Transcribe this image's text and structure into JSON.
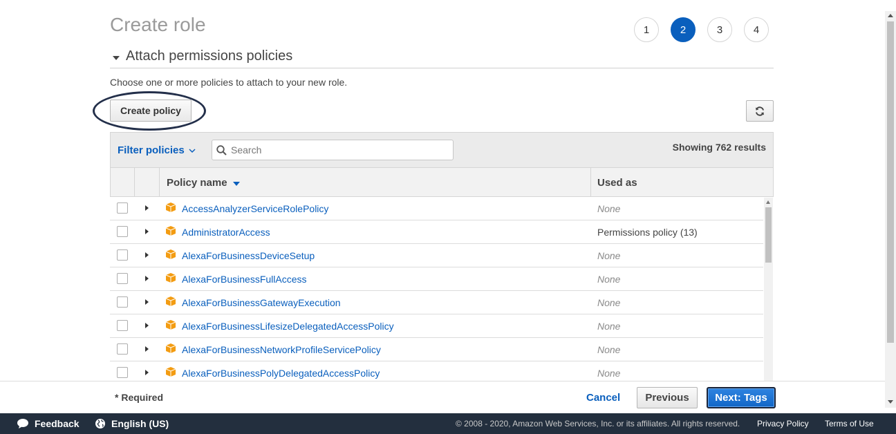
{
  "page": {
    "title": "Create role",
    "steps": [
      "1",
      "2",
      "3",
      "4"
    ],
    "active_step": "2"
  },
  "section": {
    "title": "Attach permissions policies",
    "helper": "Choose one or more policies to attach to your new role."
  },
  "toolbar": {
    "create_policy_label": "Create policy",
    "refresh_icon": "refresh-icon"
  },
  "filter": {
    "label": "Filter policies",
    "search_placeholder": "Search",
    "results": "Showing 762 results"
  },
  "table": {
    "columns": [
      "Policy name",
      "Used as"
    ],
    "rows": [
      {
        "name": "AccessAnalyzerServiceRolePolicy",
        "used_as": "None"
      },
      {
        "name": "AdministratorAccess",
        "used_as": "Permissions policy (13)"
      },
      {
        "name": "AlexaForBusinessDeviceSetup",
        "used_as": "None"
      },
      {
        "name": "AlexaForBusinessFullAccess",
        "used_as": "None"
      },
      {
        "name": "AlexaForBusinessGatewayExecution",
        "used_as": "None"
      },
      {
        "name": "AlexaForBusinessLifesizeDelegatedAccessPolicy",
        "used_as": "None"
      },
      {
        "name": "AlexaForBusinessNetworkProfileServicePolicy",
        "used_as": "None"
      },
      {
        "name": "AlexaForBusinessPolyDelegatedAccessPolicy",
        "used_as": "None"
      }
    ]
  },
  "wizard_footer": {
    "required": "* Required",
    "cancel": "Cancel",
    "previous": "Previous",
    "next": "Next: Tags"
  },
  "console_footer": {
    "feedback": "Feedback",
    "language": "English (US)",
    "copyright": "© 2008 - 2020, Amazon Web Services, Inc. or its affiliates. All rights reserved.",
    "privacy": "Privacy Policy",
    "terms": "Terms of Use"
  },
  "colors": {
    "accent": "#0a5fbd",
    "package_icon": "#f39c12",
    "console_footer_bg": "#232f3e"
  }
}
